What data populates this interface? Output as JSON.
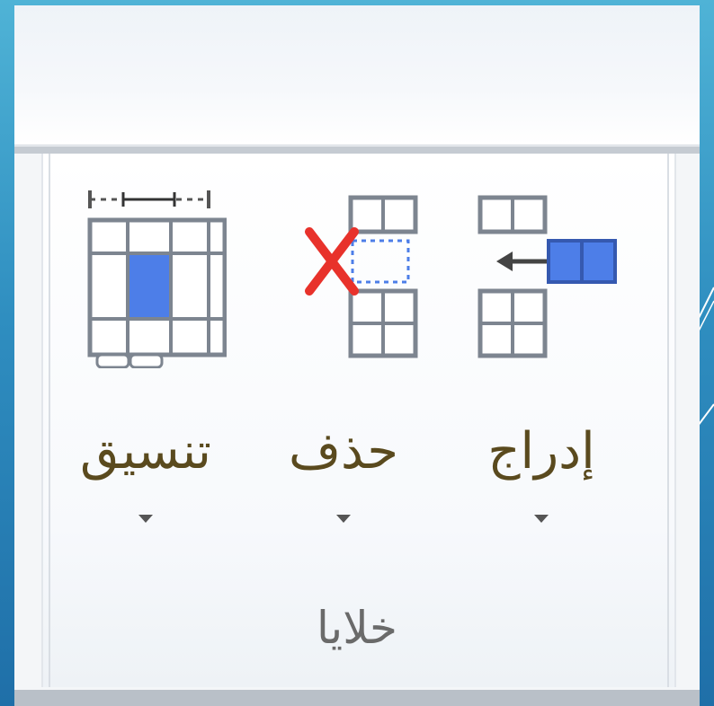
{
  "group": {
    "label": "خلايا",
    "commands": [
      {
        "id": "format",
        "label": "تنسيق",
        "icon": "format-cells-icon"
      },
      {
        "id": "delete",
        "label": "حذف",
        "icon": "delete-cells-icon"
      },
      {
        "id": "insert",
        "label": "إدراج",
        "icon": "insert-cells-icon"
      }
    ]
  },
  "colors": {
    "accent_blue": "#4d7ee8",
    "delete_red": "#e8322b",
    "grid_gray": "#7d8590"
  }
}
